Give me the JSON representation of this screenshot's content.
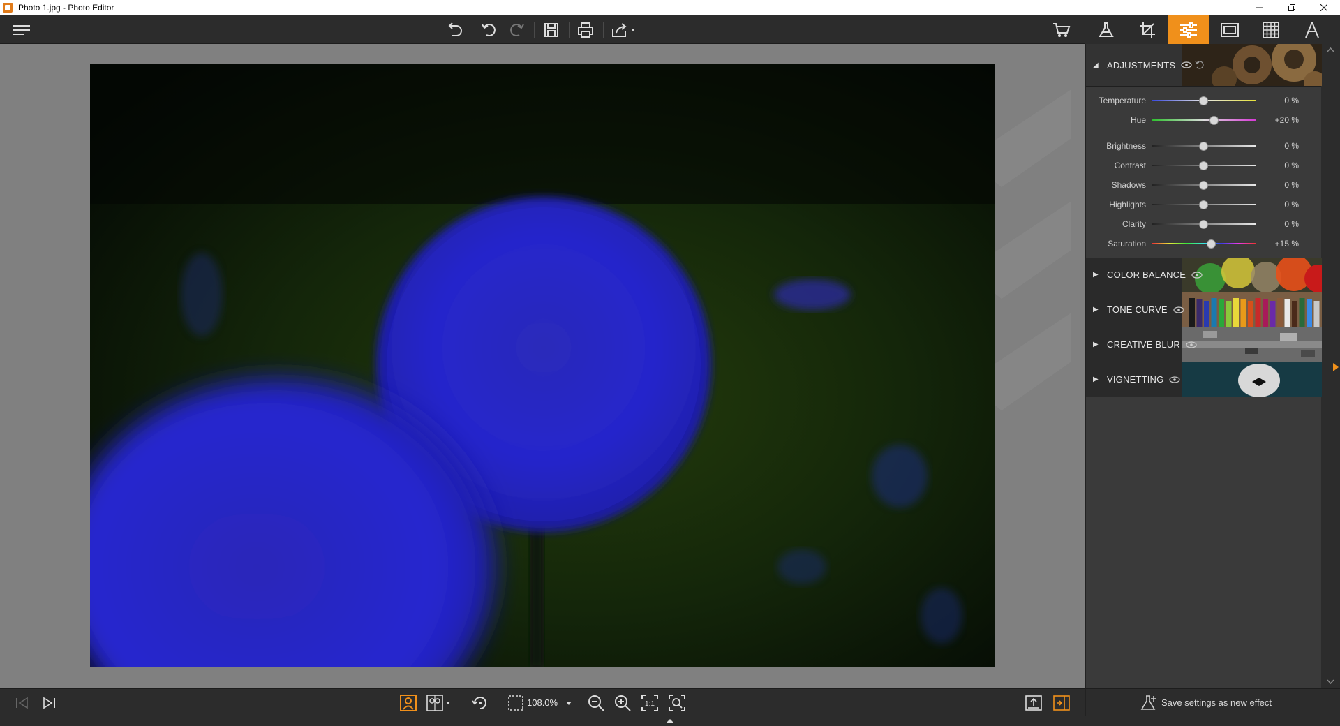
{
  "window": {
    "title": "Photo 1.jpg - Photo Editor",
    "controls": [
      "minimize",
      "restore",
      "close"
    ]
  },
  "toolbar": {
    "icons": [
      "menu-icon",
      "undo-all-icon",
      "undo-icon",
      "redo-icon",
      "save-icon",
      "print-icon",
      "share-icon",
      "cart-icon"
    ]
  },
  "right_tabs": {
    "items": [
      "effects-tab",
      "crop-tab",
      "adjustments-tab",
      "frames-tab",
      "texture-tab",
      "text-tab"
    ],
    "active": "adjustments-tab",
    "accent_color": "#f0901b"
  },
  "panel": {
    "adjustments": {
      "label": "ADJUSTMENTS",
      "expanded": true,
      "sliders": [
        {
          "label": "Temperature",
          "value": "0 %",
          "level": 0.5
        },
        {
          "label": "Hue",
          "value": "+20 %",
          "level": 0.6
        },
        {
          "label": "Brightness",
          "value": "0 %",
          "level": 0.5
        },
        {
          "label": "Contrast",
          "value": "0 %",
          "level": 0.5
        },
        {
          "label": "Shadows",
          "value": "0 %",
          "level": 0.5
        },
        {
          "label": "Highlights",
          "value": "0 %",
          "level": 0.5
        },
        {
          "label": "Clarity",
          "value": "0 %",
          "level": 0.5
        },
        {
          "label": "Saturation",
          "value": "+15 %",
          "level": 0.575
        }
      ]
    },
    "sections": [
      {
        "label": "COLOR BALANCE"
      },
      {
        "label": "TONE CURVE"
      },
      {
        "label": "CREATIVE BLUR"
      },
      {
        "label": "VIGNETTING"
      }
    ]
  },
  "bottombar": {
    "zoom": "108.0%",
    "save_effect": "Save settings as new effect"
  }
}
